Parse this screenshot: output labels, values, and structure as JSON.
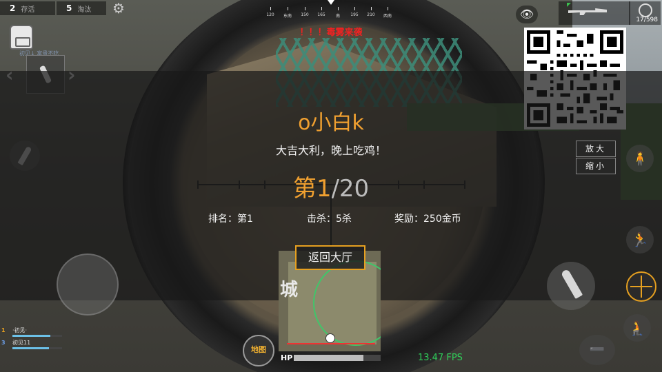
{
  "hud": {
    "alive_count": "2",
    "alive_label": "存活",
    "kill_count": "5",
    "kill_label": "淘汰",
    "gas_warning": "！！！毒雾来袭",
    "compass_labels": [
      "120",
      "东南",
      "150",
      "165",
      "南",
      "195",
      "210",
      "西南"
    ],
    "ammo": "17/598",
    "fps": "13.47 FPS",
    "hp_label": "HP",
    "hp_level": 0.8,
    "zoom_in_label": "放大",
    "zoom_out_label": "缩小",
    "map_label": "地图",
    "minimap_city": "城",
    "faint_text": "初见↓  富贵不吃"
  },
  "team": [
    {
      "number": "1",
      "name": "·初见·",
      "hp": 0.76,
      "color": "#e6a020"
    },
    {
      "number": "3",
      "name": "初见11",
      "hp": 0.74,
      "color": "#6ca0e8"
    }
  ],
  "result": {
    "player_name": "o小白k",
    "message": "大吉大利，晚上吃鸡！",
    "rank_prefix": "第",
    "rank_num": "1",
    "rank_total": "/20",
    "stat_rank": "排名：第1",
    "stat_kills": "击杀：5杀",
    "stat_reward": "奖励：250金币",
    "return_button": "返回大厅"
  },
  "icons": {
    "settings": "gear-icon",
    "view": "eye-icon",
    "weapon": "rifle-icon"
  },
  "colors": {
    "accent": "#f0a030",
    "button_border": "#e6a020",
    "warning": "#e22222",
    "fps": "#2fd05a",
    "zone_circle": "#41c56a"
  }
}
